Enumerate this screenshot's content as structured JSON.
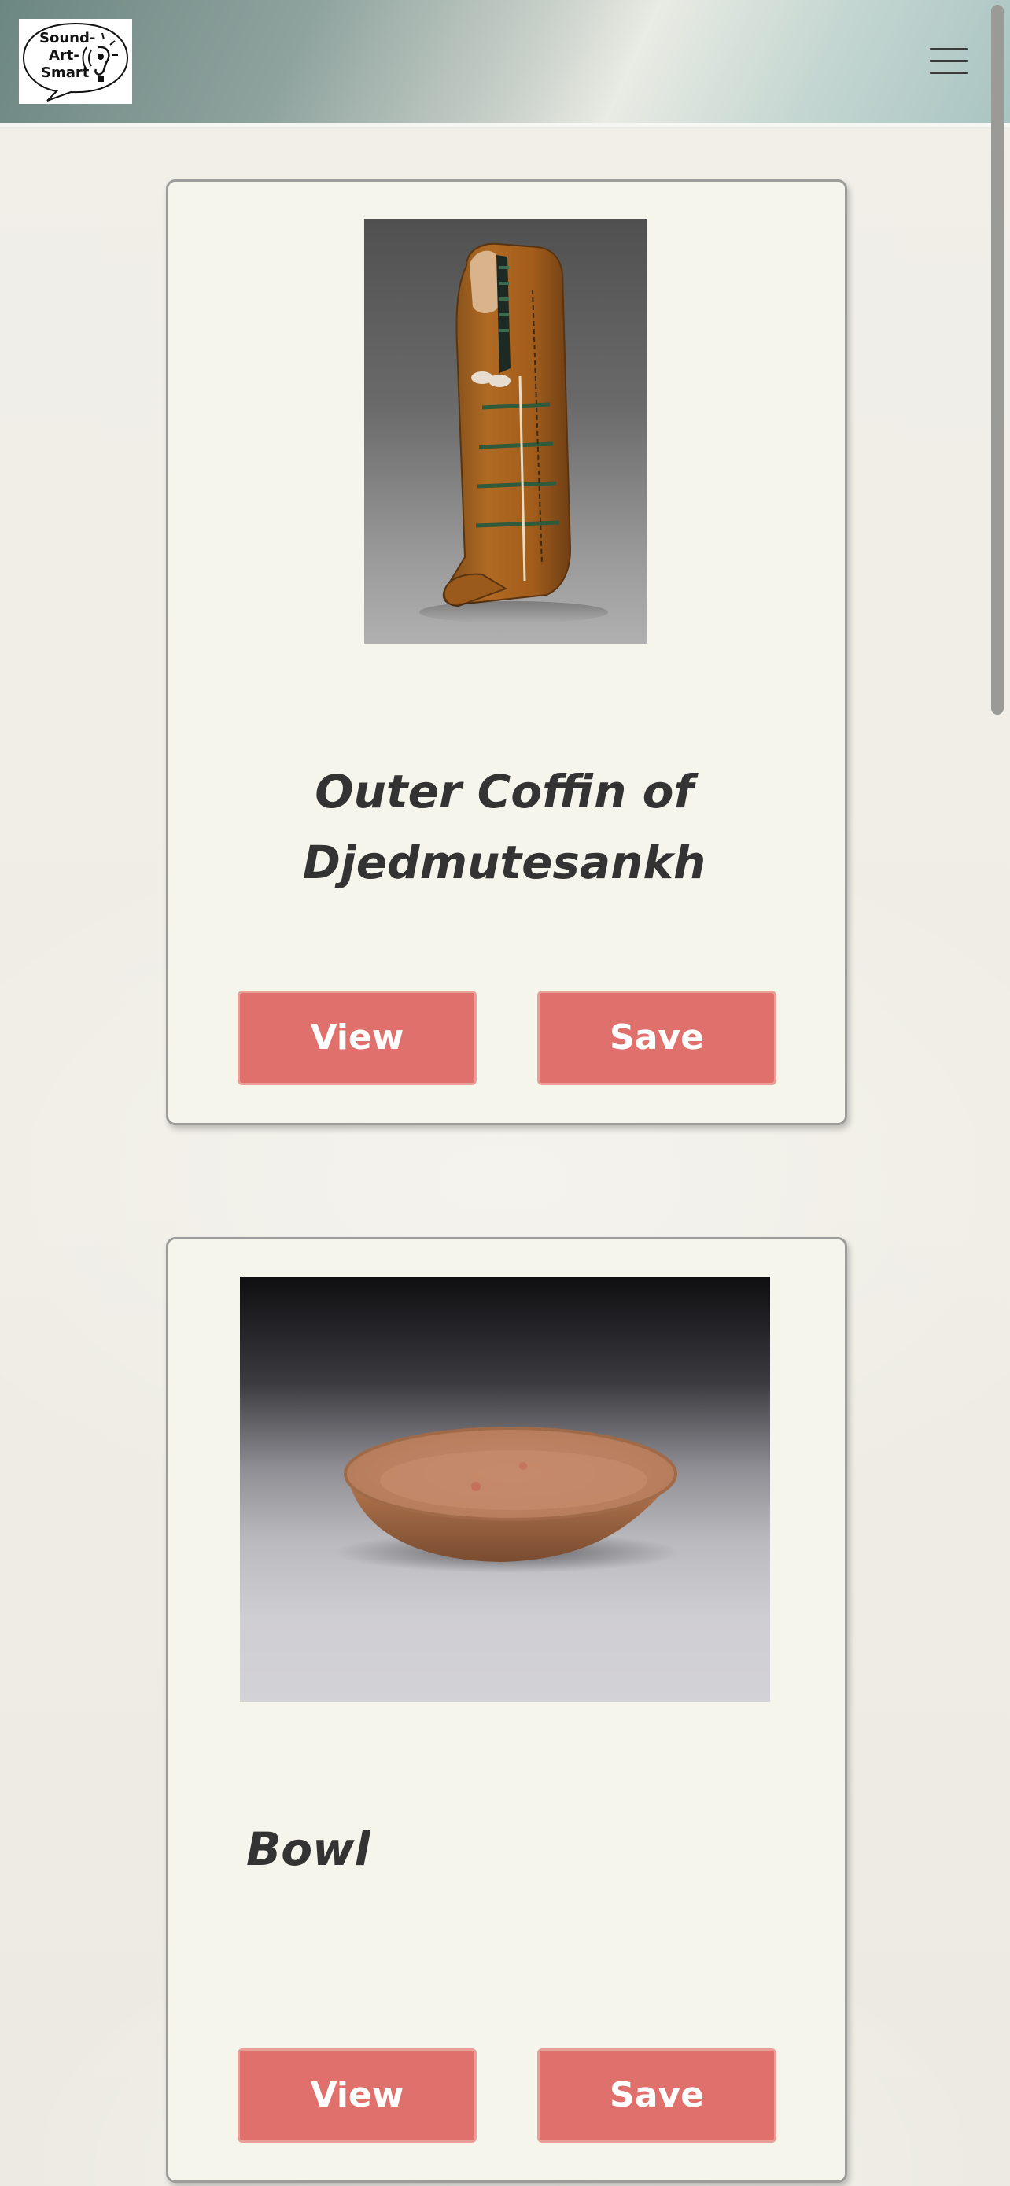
{
  "header": {
    "logo": {
      "line1": "Sound-",
      "line2": "Art-",
      "line3": "Smart",
      "icon": "ear-lightbulb-icon"
    },
    "menu_icon": "hamburger-menu-icon"
  },
  "artworks": [
    {
      "title": "Outer Coffin of Djedmutesankh",
      "image_icon": "coffin-artwork-image",
      "view_label": "View",
      "save_label": "Save"
    },
    {
      "title": "Bowl",
      "image_icon": "bowl-artwork-image",
      "view_label": "View",
      "save_label": "Save"
    }
  ],
  "colors": {
    "button": "#e0706c",
    "card": "#f6f5eb",
    "title": "#333333"
  }
}
